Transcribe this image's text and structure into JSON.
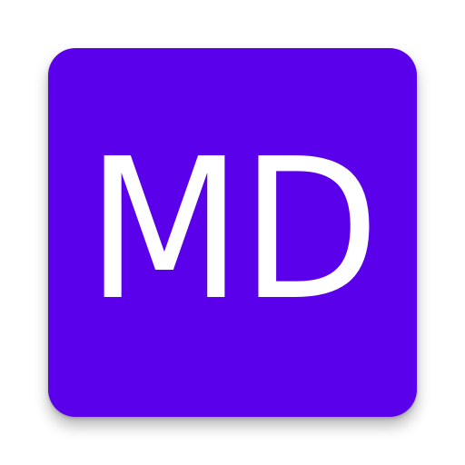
{
  "app_icon": {
    "text": "MD",
    "background_color": "#5B00EA",
    "text_color": "#FFFFFF"
  }
}
